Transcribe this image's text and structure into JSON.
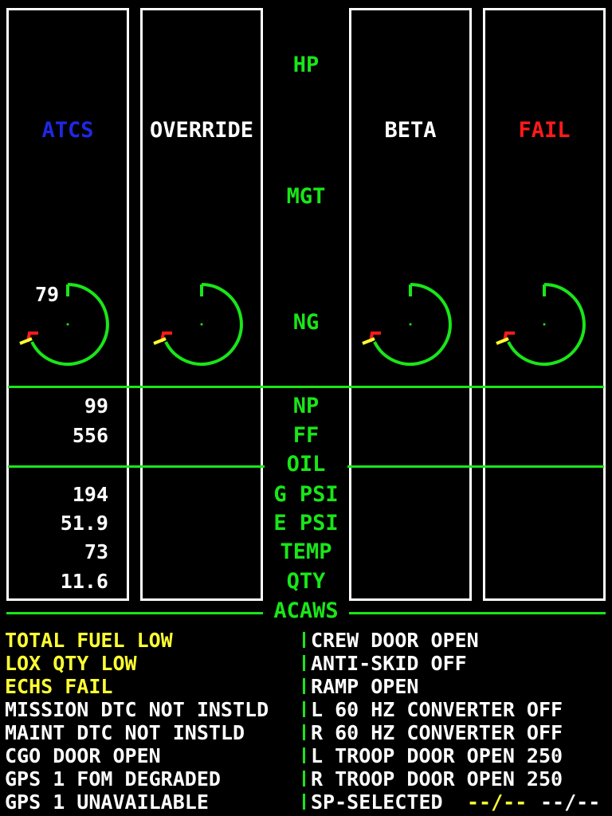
{
  "colors": {
    "green": "#19e619",
    "white": "#ffffff",
    "yellow": "#ffff33",
    "blue": "#1e28e6",
    "red": "#ff1a1a"
  },
  "labels": {
    "hp": "HP",
    "mgt": "MGT",
    "ng": "NG",
    "np": "NP",
    "ff": "FF",
    "oil": "OIL",
    "g_psi": "G PSI",
    "e_psi": "E PSI",
    "temp": "TEMP",
    "qty": "QTY",
    "acaws": "ACAWS"
  },
  "engines": [
    {
      "status": "ATCS",
      "status_color": "#1e28e6",
      "ng": "79",
      "np": "99",
      "ff": "556",
      "g_psi": "194",
      "e_psi": "51.9",
      "temp": "73",
      "qty": "11.6"
    },
    {
      "status": "OVERRIDE",
      "status_color": "#ffffff"
    },
    {
      "status": "BETA",
      "status_color": "#ffffff"
    },
    {
      "status": "FAIL",
      "status_color": "#ff1a1a"
    }
  ],
  "acaws": {
    "left": [
      {
        "text": "TOTAL FUEL LOW",
        "level": "caution"
      },
      {
        "text": "LOX QTY LOW",
        "level": "caution"
      },
      {
        "text": "ECHS FAIL",
        "level": "caution"
      },
      {
        "text": "MISSION DTC NOT INSTLD",
        "level": "advisory"
      },
      {
        "text": "MAINT DTC NOT INSTLD",
        "level": "advisory"
      },
      {
        "text": "CGO DOOR OPEN",
        "level": "advisory"
      },
      {
        "text": "GPS 1 FOM DEGRADED",
        "level": "advisory"
      },
      {
        "text": "GPS 1 UNAVAILABLE",
        "level": "advisory"
      }
    ],
    "right": [
      "CREW DOOR OPEN",
      "ANTI-SKID OFF",
      "RAMP OPEN",
      "L 60 HZ CONVERTER OFF",
      "R 60 HZ CONVERTER OFF",
      "L TROOP DOOR OPEN 250",
      "R TROOP DOOR OPEN 250",
      "SP-SELECTED"
    ],
    "sp_values": [
      "--/--",
      "--/--"
    ]
  }
}
